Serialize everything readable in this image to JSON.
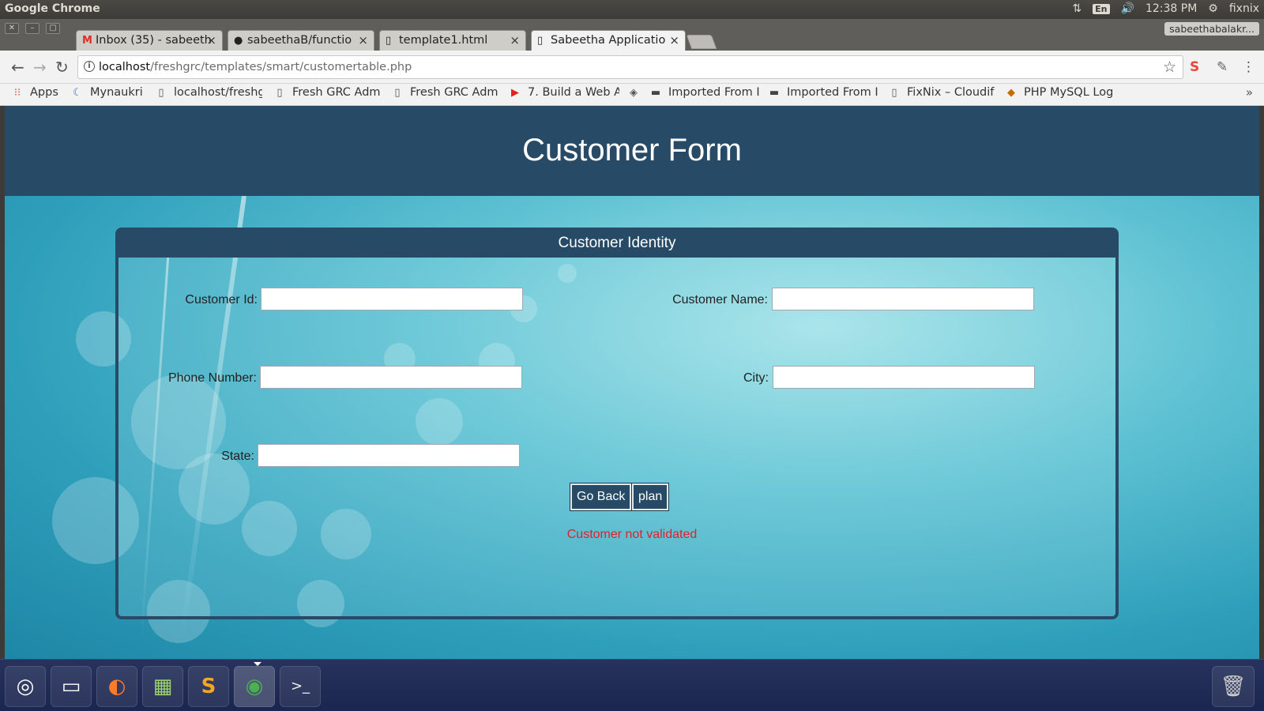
{
  "os": {
    "app_title": "Google Chrome",
    "lang": "En",
    "clock": "12:38 PM",
    "user": "fixnix"
  },
  "browser": {
    "profile": "sabeethabalakr...",
    "tabs": [
      {
        "label": "Inbox (35) - sabeeth",
        "icon": "gmail-icon"
      },
      {
        "label": "sabeethaB/functio",
        "icon": "github-icon"
      },
      {
        "label": "template1.html",
        "icon": "page-icon"
      },
      {
        "label": "Sabeetha Applicatio",
        "icon": "page-icon"
      }
    ],
    "url_host": "localhost",
    "url_path": "/freshgrc/templates/smart/customertable.php",
    "bookmarks": [
      {
        "label": "Apps",
        "icon": "apps-grid-icon"
      },
      {
        "label": "Mynaukri",
        "icon": "naukri-icon"
      },
      {
        "label": "localhost/freshg",
        "icon": "page-icon"
      },
      {
        "label": "Fresh GRC Admi",
        "icon": "page-icon"
      },
      {
        "label": "Fresh GRC Admi",
        "icon": "page-icon"
      },
      {
        "label": "7. Build a Web A",
        "icon": "youtube-icon"
      },
      {
        "label": "",
        "icon": "diamond-icon"
      },
      {
        "label": "Imported From I",
        "icon": "folder-icon"
      },
      {
        "label": "Imported From I",
        "icon": "folder-icon"
      },
      {
        "label": "FixNix – Cloudif",
        "icon": "page-icon"
      },
      {
        "label": "PHP MySQL Log",
        "icon": "php-icon"
      }
    ]
  },
  "page": {
    "header_title": "Customer Form",
    "panel_title": "Customer Identity",
    "fields": {
      "customer_id_label": "Customer Id:",
      "customer_name_label": "Customer Name:",
      "phone_label": "Phone Number:",
      "city_label": "City:",
      "state_label": "State:",
      "customer_id_value": "",
      "customer_name_value": "",
      "phone_value": "",
      "city_value": "",
      "state_value": ""
    },
    "go_back_label": "Go Back",
    "plan_label": "plan",
    "status_message": "Customer not validated"
  },
  "colors": {
    "header_bg": "#274b66",
    "status_error": "#e0202c"
  }
}
